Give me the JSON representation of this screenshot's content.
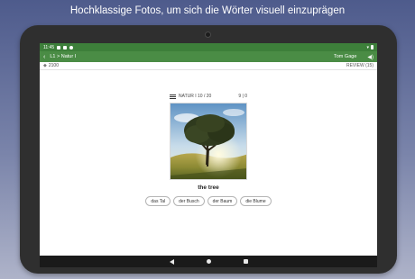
{
  "caption": "Hochklassige Fotos, um sich die Wörter visuell einzuprägen",
  "statusbar": {
    "time": "11:45",
    "battery": ""
  },
  "appbar": {
    "breadcrumb": "L1 > Natur I",
    "tomorrow_label": "Tom Gage"
  },
  "infobar": {
    "coins": "2100",
    "review_label": "REVIEW (15)"
  },
  "lesson": {
    "title": "NATUR I  10 / 20",
    "counter": "9 | 0"
  },
  "card": {
    "word": "the tree"
  },
  "choices": [
    "das Tal",
    "der Busch",
    "der Baum",
    "die Blume"
  ],
  "colors": {
    "statusbar": "#3d7f3a",
    "appbar": "#4a8c45",
    "background": "#5a6596"
  }
}
